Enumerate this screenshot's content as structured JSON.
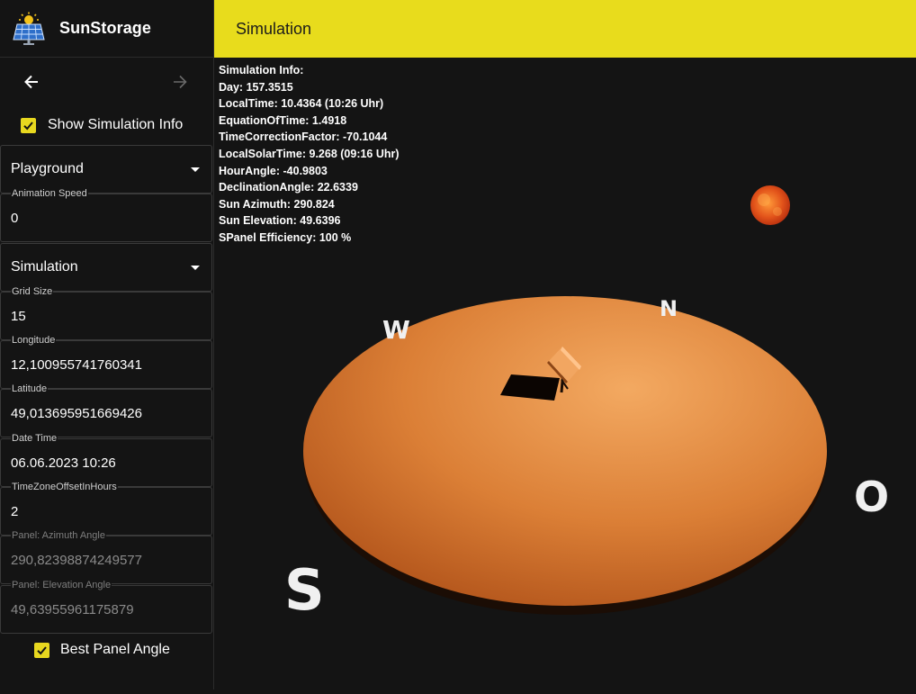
{
  "app": {
    "name": "SunStorage",
    "title": "Simulation"
  },
  "nav": {
    "back_icon": "arrow-left-icon",
    "forward_icon": "arrow-right-icon"
  },
  "show_info": {
    "label": "Show Simulation Info",
    "checked": true
  },
  "playground": {
    "label": "Playground"
  },
  "animation_speed": {
    "label": "Animation Speed",
    "value": "0"
  },
  "simulation_select": {
    "label": "Simulation"
  },
  "fields": [
    {
      "label": "Grid Size",
      "value": "15"
    },
    {
      "label": "Longitude",
      "value": "12,100955741760341"
    },
    {
      "label": "Latitude",
      "value": "49,013695951669426"
    },
    {
      "label": "Date Time",
      "value": "06.06.2023 10:26"
    },
    {
      "label": "TimeZoneOffsetInHours",
      "value": "2"
    },
    {
      "label": "Panel: Azimuth Angle",
      "value": "290,82398874249577"
    },
    {
      "label": "Panel: Elevation Angle",
      "value": "49,63955961175879"
    }
  ],
  "best_panel": {
    "label": "Best Panel Angle",
    "checked": true
  },
  "sim_info": [
    "Simulation Info:",
    "Day: 157.3515",
    "LocalTime: 10.4364 (10:26 Uhr)",
    "EquationOfTime: 1.4918",
    "TimeCorrectionFactor: -70.1044",
    "LocalSolarTime: 9.268 (09:16 Uhr)",
    "HourAngle: -40.9803",
    "DeclinationAngle: 22.6339",
    "Sun Azimuth: 290.824",
    "Sun Elevation: 49.6396",
    "SPanel Efficiency: 100 %"
  ],
  "compass": {
    "north": "N",
    "west": "W",
    "south": "S",
    "east": "O"
  },
  "colors": {
    "accent": "#e8dc1c",
    "ground": "#d97e35",
    "background": "#141414"
  }
}
